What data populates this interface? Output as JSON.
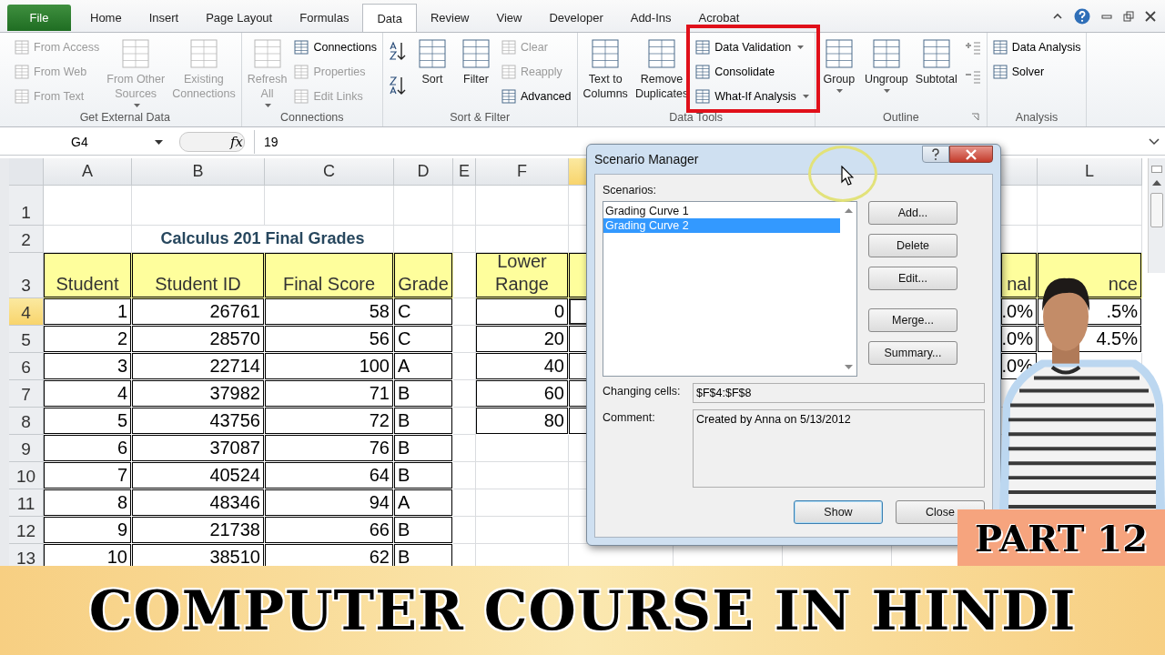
{
  "tabs": [
    {
      "label": "File",
      "kind": "file",
      "selected": false
    },
    {
      "label": "Home",
      "kind": "tab",
      "selected": false
    },
    {
      "label": "Insert",
      "kind": "tab",
      "selected": false
    },
    {
      "label": "Page Layout",
      "kind": "tab",
      "selected": false
    },
    {
      "label": "Formulas",
      "kind": "tab",
      "selected": false
    },
    {
      "label": "Data",
      "kind": "tab",
      "selected": true
    },
    {
      "label": "Review",
      "kind": "tab",
      "selected": false
    },
    {
      "label": "View",
      "kind": "tab",
      "selected": false
    },
    {
      "label": "Developer",
      "kind": "tab",
      "selected": false
    },
    {
      "label": "Add-Ins",
      "kind": "tab",
      "selected": false
    },
    {
      "label": "Acrobat",
      "kind": "tab",
      "selected": false
    }
  ],
  "ribbon": {
    "groups": [
      {
        "label": "Get External Data",
        "items": [
          {
            "kind": "stack",
            "items": [
              {
                "label": "From Access",
                "disabled": true,
                "dropdown": false
              },
              {
                "label": "From Web",
                "disabled": true,
                "dropdown": false
              },
              {
                "label": "From Text",
                "disabled": true,
                "dropdown": false
              }
            ]
          },
          {
            "kind": "large",
            "label": "From Other\nSources",
            "disabled": true,
            "dropdown": true
          },
          {
            "kind": "large",
            "label": "Existing\nConnections",
            "disabled": true,
            "dropdown": false
          }
        ]
      },
      {
        "label": "Connections",
        "items": [
          {
            "kind": "large",
            "label": "Refresh\nAll",
            "disabled": true,
            "dropdown": true
          },
          {
            "kind": "stack",
            "items": [
              {
                "label": "Connections",
                "disabled": false,
                "dropdown": false
              },
              {
                "label": "Properties",
                "disabled": true,
                "dropdown": false
              },
              {
                "label": "Edit Links",
                "disabled": true,
                "dropdown": false
              }
            ]
          }
        ]
      },
      {
        "label": "Sort & Filter",
        "items": [
          {
            "kind": "sort_buttons"
          },
          {
            "kind": "large",
            "label": "Sort",
            "disabled": false,
            "dropdown": false
          },
          {
            "kind": "large",
            "label": "Filter",
            "disabled": false,
            "dropdown": false
          },
          {
            "kind": "stack",
            "items": [
              {
                "label": "Clear",
                "disabled": true,
                "dropdown": false
              },
              {
                "label": "Reapply",
                "disabled": true,
                "dropdown": false
              },
              {
                "label": "Advanced",
                "disabled": false,
                "dropdown": false
              }
            ]
          }
        ]
      },
      {
        "label": "Data Tools",
        "items": [
          {
            "kind": "large",
            "label": "Text to\nColumns",
            "disabled": false,
            "dropdown": false
          },
          {
            "kind": "large",
            "label": "Remove\nDuplicates",
            "disabled": false,
            "dropdown": false
          },
          {
            "kind": "stack",
            "highlighted": true,
            "items": [
              {
                "label": "Data Validation",
                "disabled": false,
                "dropdown": true
              },
              {
                "label": "Consolidate",
                "disabled": false,
                "dropdown": false
              },
              {
                "label": "What-If Analysis",
                "disabled": false,
                "dropdown": true
              }
            ]
          }
        ]
      },
      {
        "label": "Outline",
        "launcher": true,
        "items": [
          {
            "kind": "large",
            "label": "Group",
            "disabled": false,
            "dropdown": true
          },
          {
            "kind": "large",
            "label": "Ungroup",
            "disabled": false,
            "dropdown": true
          },
          {
            "kind": "large",
            "label": "Subtotal",
            "disabled": false,
            "dropdown": false
          },
          {
            "kind": "detail_buttons"
          }
        ]
      },
      {
        "label": "Analysis",
        "items": [
          {
            "kind": "stack",
            "items": [
              {
                "label": "Data Analysis",
                "disabled": false,
                "dropdown": false
              },
              {
                "label": "Solver",
                "disabled": false,
                "dropdown": false
              }
            ]
          }
        ]
      }
    ]
  },
  "formula_bar": {
    "name_box": "G4",
    "fx_symbol": "fx",
    "value": "19"
  },
  "sheet": {
    "columns": [
      {
        "label": "A",
        "selected": false
      },
      {
        "label": "B",
        "selected": false
      },
      {
        "label": "C",
        "selected": false
      },
      {
        "label": "D",
        "selected": false
      },
      {
        "label": "E",
        "selected": false
      },
      {
        "label": "F",
        "selected": false
      },
      {
        "selected": true
      },
      {},
      {},
      {},
      {
        "selected": false
      },
      {
        "label": "L",
        "selected": false
      }
    ],
    "rows": [
      {
        "header": "1",
        "selected": false,
        "cells": []
      },
      {
        "header": "2",
        "selected": false,
        "cells": [
          null,
          {
            "kind": "title",
            "text": "Calculus 201 Final Grades"
          }
        ]
      },
      {
        "header": "3",
        "selected": false,
        "cells": [
          {
            "kind": "heading",
            "text": "Student"
          },
          {
            "kind": "heading",
            "text": "Student ID"
          },
          {
            "kind": "heading",
            "text": "Final Score"
          },
          {
            "kind": "heading",
            "text": "Grade"
          },
          null,
          {
            "kind": "heading",
            "text": "Lower\nRange"
          },
          {
            "kind": "heading"
          },
          null,
          null,
          null,
          {
            "kind": "heading",
            "text": "nal"
          },
          {
            "kind": "heading",
            "text": "nce"
          }
        ]
      },
      {
        "header": "4",
        "selected": true,
        "cells": [
          {
            "kind": "number",
            "text": "1"
          },
          {
            "kind": "number",
            "text": "26761"
          },
          {
            "kind": "number",
            "text": "58"
          },
          {
            "kind": "text",
            "text": "C"
          },
          null,
          {
            "kind": "number",
            "text": "0"
          },
          {
            "kind": "number",
            "selected": true
          },
          null,
          null,
          null,
          {
            "kind": "number",
            "text": ".0%"
          },
          {
            "kind": "number",
            "text": ".5%"
          }
        ]
      },
      {
        "header": "5",
        "selected": false,
        "cells": [
          {
            "kind": "number",
            "text": "2"
          },
          {
            "kind": "number",
            "text": "28570"
          },
          {
            "kind": "number",
            "text": "56"
          },
          {
            "kind": "text",
            "text": "C"
          },
          null,
          {
            "kind": "number",
            "text": "20"
          },
          {
            "kind": "number"
          },
          null,
          null,
          null,
          {
            "kind": "number",
            "text": ".0%"
          },
          {
            "kind": "number",
            "text": "4.5%"
          }
        ]
      },
      {
        "header": "6",
        "selected": false,
        "cells": [
          {
            "kind": "number",
            "text": "3"
          },
          {
            "kind": "number",
            "text": "22714"
          },
          {
            "kind": "number",
            "text": "100"
          },
          {
            "kind": "text",
            "text": "A"
          },
          null,
          {
            "kind": "number",
            "text": "40"
          },
          {
            "kind": "number"
          },
          null,
          null,
          null,
          {
            "kind": "number",
            "text": ".0%"
          }
        ]
      },
      {
        "header": "7",
        "selected": false,
        "cells": [
          {
            "kind": "number",
            "text": "4"
          },
          {
            "kind": "number",
            "text": "37982"
          },
          {
            "kind": "number",
            "text": "71"
          },
          {
            "kind": "text",
            "text": "B"
          },
          null,
          {
            "kind": "number",
            "text": "60"
          },
          {
            "kind": "number"
          }
        ]
      },
      {
        "header": "8",
        "selected": false,
        "cells": [
          {
            "kind": "number",
            "text": "5"
          },
          {
            "kind": "number",
            "text": "43756"
          },
          {
            "kind": "number",
            "text": "72"
          },
          {
            "kind": "text",
            "text": "B"
          },
          null,
          {
            "kind": "number",
            "text": "80"
          },
          {
            "kind": "number"
          }
        ]
      },
      {
        "header": "9",
        "selected": false,
        "cells": [
          {
            "kind": "number",
            "text": "6"
          },
          {
            "kind": "number",
            "text": "37087"
          },
          {
            "kind": "number",
            "text": "76"
          },
          {
            "kind": "text",
            "text": "B"
          }
        ]
      },
      {
        "header": "10",
        "selected": false,
        "cells": [
          {
            "kind": "number",
            "text": "7"
          },
          {
            "kind": "number",
            "text": "40524"
          },
          {
            "kind": "number",
            "text": "64"
          },
          {
            "kind": "text",
            "text": "B"
          }
        ]
      },
      {
        "header": "11",
        "selected": false,
        "cells": [
          {
            "kind": "number",
            "text": "8"
          },
          {
            "kind": "number",
            "text": "48346"
          },
          {
            "kind": "number",
            "text": "94"
          },
          {
            "kind": "text",
            "text": "A"
          }
        ]
      },
      {
        "header": "12",
        "selected": false,
        "cells": [
          {
            "kind": "number",
            "text": "9"
          },
          {
            "kind": "number",
            "text": "21738"
          },
          {
            "kind": "number",
            "text": "66"
          },
          {
            "kind": "text",
            "text": "B"
          }
        ]
      },
      {
        "header": "13",
        "selected": false,
        "cells": [
          {
            "kind": "number",
            "text": "10"
          },
          {
            "kind": "number",
            "text": "38510"
          },
          {
            "kind": "number",
            "text": "62"
          },
          {
            "kind": "text",
            "text": "B"
          }
        ]
      }
    ]
  },
  "dialog": {
    "title": "Scenario Manager",
    "scenarios_label": "Scenarios:",
    "scenarios": [
      {
        "label": "Grading Curve 1",
        "selected": false
      },
      {
        "label": "Grading Curve 2",
        "selected": true
      }
    ],
    "side_buttons": [
      {
        "label": "Add..."
      },
      {
        "label": "Delete"
      },
      {
        "label": "Edit..."
      },
      {
        "label": "Merge..."
      },
      {
        "label": "Summary..."
      }
    ],
    "changing_cells_label": "Changing cells:",
    "changing_cells": "$F$4:$F$8",
    "comment_label": "Comment:",
    "comment": "Created by Anna on 5/13/2012",
    "footer_buttons": [
      {
        "label": "Show",
        "default": true
      },
      {
        "label": "Close",
        "default": false
      }
    ]
  },
  "badge": "PART 12",
  "banner": "COMPUTER COURSE IN HINDI"
}
